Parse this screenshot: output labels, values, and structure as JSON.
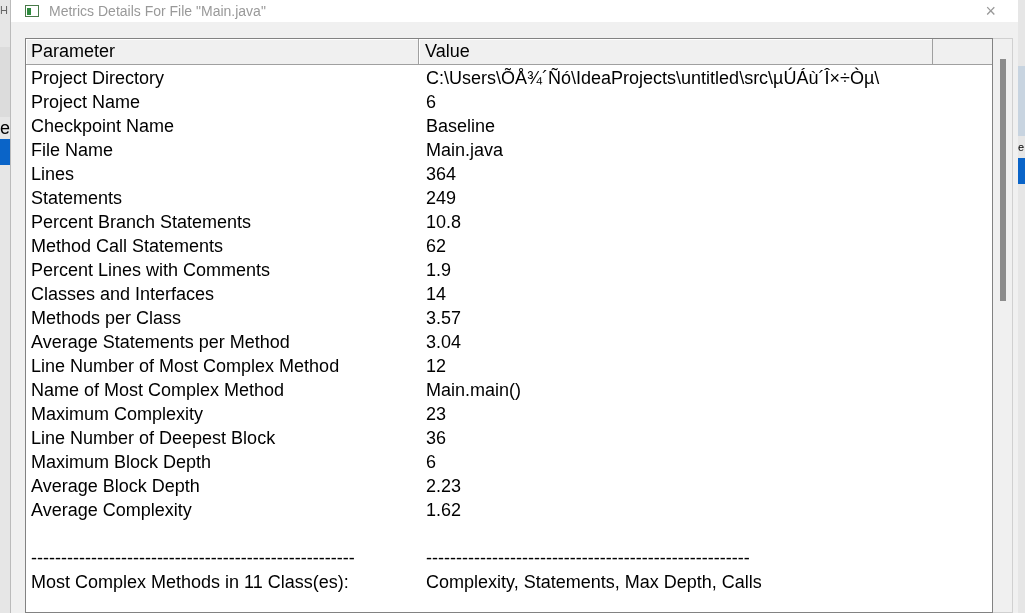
{
  "background_window": {
    "left_fragments": [
      "H",
      "e"
    ],
    "right_fragments": [
      "e"
    ]
  },
  "window": {
    "title": "Metrics Details For File \"Main.java\"",
    "close": "×"
  },
  "table": {
    "columns": [
      "Parameter",
      "Value"
    ],
    "rows": [
      {
        "parameter": "Project Directory",
        "value": "C:\\Users\\ÕÅ¾´Ñó\\IdeaProjects\\untitled\\src\\µÚÁù´Î×÷Òµ\\"
      },
      {
        "parameter": "Project Name",
        "value": "6"
      },
      {
        "parameter": "Checkpoint Name",
        "value": "Baseline"
      },
      {
        "parameter": "File Name",
        "value": "Main.java"
      },
      {
        "parameter": "Lines",
        "value": "364"
      },
      {
        "parameter": "Statements",
        "value": "249"
      },
      {
        "parameter": "Percent Branch Statements",
        "value": "10.8"
      },
      {
        "parameter": "Method Call Statements",
        "value": "62"
      },
      {
        "parameter": "Percent Lines with Comments",
        "value": "1.9"
      },
      {
        "parameter": "Classes and Interfaces",
        "value": "14"
      },
      {
        "parameter": "Methods per Class",
        "value": "3.57"
      },
      {
        "parameter": "Average Statements per Method",
        "value": "3.04"
      },
      {
        "parameter": "Line Number of Most Complex Method",
        "value": "12"
      },
      {
        "parameter": "Name of Most Complex Method",
        "value": "Main.main()"
      },
      {
        "parameter": "Maximum Complexity",
        "value": "23"
      },
      {
        "parameter": "Line Number of Deepest Block",
        "value": "36"
      },
      {
        "parameter": "Maximum Block Depth",
        "value": "6"
      },
      {
        "parameter": "Average Block Depth",
        "value": "2.23"
      },
      {
        "parameter": "Average Complexity",
        "value": "1.62"
      }
    ],
    "footer_rows": [
      {
        "parameter": "------------------------------------------------------",
        "value": "------------------------------------------------------"
      },
      {
        "parameter": "Most Complex Methods in 11 Class(es):",
        "value": "Complexity, Statements, Max Depth, Calls"
      }
    ]
  }
}
